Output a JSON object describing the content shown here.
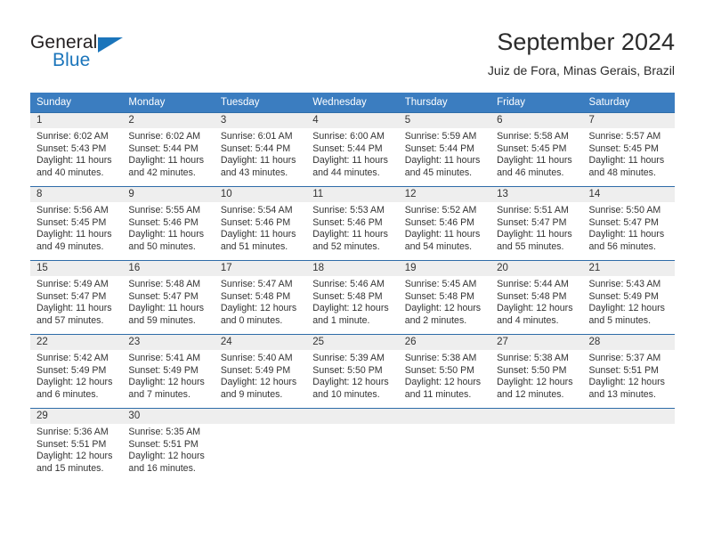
{
  "brand": {
    "name_part1": "General",
    "name_part2": "Blue",
    "logo_color": "#1b75bb"
  },
  "header": {
    "month_title": "September 2024",
    "location": "Juiz de Fora, Minas Gerais, Brazil"
  },
  "theme": {
    "header_bg": "#3b7dc0",
    "row_border": "#2e6ca8",
    "daynum_bg": "#eeeeee"
  },
  "weekday_headers": [
    "Sunday",
    "Monday",
    "Tuesday",
    "Wednesday",
    "Thursday",
    "Friday",
    "Saturday"
  ],
  "weeks": [
    [
      {
        "day": "1",
        "sunrise": "Sunrise: 6:02 AM",
        "sunset": "Sunset: 5:43 PM",
        "daylight_line1": "Daylight: 11 hours",
        "daylight_line2": "and 40 minutes."
      },
      {
        "day": "2",
        "sunrise": "Sunrise: 6:02 AM",
        "sunset": "Sunset: 5:44 PM",
        "daylight_line1": "Daylight: 11 hours",
        "daylight_line2": "and 42 minutes."
      },
      {
        "day": "3",
        "sunrise": "Sunrise: 6:01 AM",
        "sunset": "Sunset: 5:44 PM",
        "daylight_line1": "Daylight: 11 hours",
        "daylight_line2": "and 43 minutes."
      },
      {
        "day": "4",
        "sunrise": "Sunrise: 6:00 AM",
        "sunset": "Sunset: 5:44 PM",
        "daylight_line1": "Daylight: 11 hours",
        "daylight_line2": "and 44 minutes."
      },
      {
        "day": "5",
        "sunrise": "Sunrise: 5:59 AM",
        "sunset": "Sunset: 5:44 PM",
        "daylight_line1": "Daylight: 11 hours",
        "daylight_line2": "and 45 minutes."
      },
      {
        "day": "6",
        "sunrise": "Sunrise: 5:58 AM",
        "sunset": "Sunset: 5:45 PM",
        "daylight_line1": "Daylight: 11 hours",
        "daylight_line2": "and 46 minutes."
      },
      {
        "day": "7",
        "sunrise": "Sunrise: 5:57 AM",
        "sunset": "Sunset: 5:45 PM",
        "daylight_line1": "Daylight: 11 hours",
        "daylight_line2": "and 48 minutes."
      }
    ],
    [
      {
        "day": "8",
        "sunrise": "Sunrise: 5:56 AM",
        "sunset": "Sunset: 5:45 PM",
        "daylight_line1": "Daylight: 11 hours",
        "daylight_line2": "and 49 minutes."
      },
      {
        "day": "9",
        "sunrise": "Sunrise: 5:55 AM",
        "sunset": "Sunset: 5:46 PM",
        "daylight_line1": "Daylight: 11 hours",
        "daylight_line2": "and 50 minutes."
      },
      {
        "day": "10",
        "sunrise": "Sunrise: 5:54 AM",
        "sunset": "Sunset: 5:46 PM",
        "daylight_line1": "Daylight: 11 hours",
        "daylight_line2": "and 51 minutes."
      },
      {
        "day": "11",
        "sunrise": "Sunrise: 5:53 AM",
        "sunset": "Sunset: 5:46 PM",
        "daylight_line1": "Daylight: 11 hours",
        "daylight_line2": "and 52 minutes."
      },
      {
        "day": "12",
        "sunrise": "Sunrise: 5:52 AM",
        "sunset": "Sunset: 5:46 PM",
        "daylight_line1": "Daylight: 11 hours",
        "daylight_line2": "and 54 minutes."
      },
      {
        "day": "13",
        "sunrise": "Sunrise: 5:51 AM",
        "sunset": "Sunset: 5:47 PM",
        "daylight_line1": "Daylight: 11 hours",
        "daylight_line2": "and 55 minutes."
      },
      {
        "day": "14",
        "sunrise": "Sunrise: 5:50 AM",
        "sunset": "Sunset: 5:47 PM",
        "daylight_line1": "Daylight: 11 hours",
        "daylight_line2": "and 56 minutes."
      }
    ],
    [
      {
        "day": "15",
        "sunrise": "Sunrise: 5:49 AM",
        "sunset": "Sunset: 5:47 PM",
        "daylight_line1": "Daylight: 11 hours",
        "daylight_line2": "and 57 minutes."
      },
      {
        "day": "16",
        "sunrise": "Sunrise: 5:48 AM",
        "sunset": "Sunset: 5:47 PM",
        "daylight_line1": "Daylight: 11 hours",
        "daylight_line2": "and 59 minutes."
      },
      {
        "day": "17",
        "sunrise": "Sunrise: 5:47 AM",
        "sunset": "Sunset: 5:48 PM",
        "daylight_line1": "Daylight: 12 hours",
        "daylight_line2": "and 0 minutes."
      },
      {
        "day": "18",
        "sunrise": "Sunrise: 5:46 AM",
        "sunset": "Sunset: 5:48 PM",
        "daylight_line1": "Daylight: 12 hours",
        "daylight_line2": "and 1 minute."
      },
      {
        "day": "19",
        "sunrise": "Sunrise: 5:45 AM",
        "sunset": "Sunset: 5:48 PM",
        "daylight_line1": "Daylight: 12 hours",
        "daylight_line2": "and 2 minutes."
      },
      {
        "day": "20",
        "sunrise": "Sunrise: 5:44 AM",
        "sunset": "Sunset: 5:48 PM",
        "daylight_line1": "Daylight: 12 hours",
        "daylight_line2": "and 4 minutes."
      },
      {
        "day": "21",
        "sunrise": "Sunrise: 5:43 AM",
        "sunset": "Sunset: 5:49 PM",
        "daylight_line1": "Daylight: 12 hours",
        "daylight_line2": "and 5 minutes."
      }
    ],
    [
      {
        "day": "22",
        "sunrise": "Sunrise: 5:42 AM",
        "sunset": "Sunset: 5:49 PM",
        "daylight_line1": "Daylight: 12 hours",
        "daylight_line2": "and 6 minutes."
      },
      {
        "day": "23",
        "sunrise": "Sunrise: 5:41 AM",
        "sunset": "Sunset: 5:49 PM",
        "daylight_line1": "Daylight: 12 hours",
        "daylight_line2": "and 7 minutes."
      },
      {
        "day": "24",
        "sunrise": "Sunrise: 5:40 AM",
        "sunset": "Sunset: 5:49 PM",
        "daylight_line1": "Daylight: 12 hours",
        "daylight_line2": "and 9 minutes."
      },
      {
        "day": "25",
        "sunrise": "Sunrise: 5:39 AM",
        "sunset": "Sunset: 5:50 PM",
        "daylight_line1": "Daylight: 12 hours",
        "daylight_line2": "and 10 minutes."
      },
      {
        "day": "26",
        "sunrise": "Sunrise: 5:38 AM",
        "sunset": "Sunset: 5:50 PM",
        "daylight_line1": "Daylight: 12 hours",
        "daylight_line2": "and 11 minutes."
      },
      {
        "day": "27",
        "sunrise": "Sunrise: 5:38 AM",
        "sunset": "Sunset: 5:50 PM",
        "daylight_line1": "Daylight: 12 hours",
        "daylight_line2": "and 12 minutes."
      },
      {
        "day": "28",
        "sunrise": "Sunrise: 5:37 AM",
        "sunset": "Sunset: 5:51 PM",
        "daylight_line1": "Daylight: 12 hours",
        "daylight_line2": "and 13 minutes."
      }
    ],
    [
      {
        "day": "29",
        "sunrise": "Sunrise: 5:36 AM",
        "sunset": "Sunset: 5:51 PM",
        "daylight_line1": "Daylight: 12 hours",
        "daylight_line2": "and 15 minutes."
      },
      {
        "day": "30",
        "sunrise": "Sunrise: 5:35 AM",
        "sunset": "Sunset: 5:51 PM",
        "daylight_line1": "Daylight: 12 hours",
        "daylight_line2": "and 16 minutes."
      },
      {
        "day": "",
        "sunrise": "",
        "sunset": "",
        "daylight_line1": "",
        "daylight_line2": ""
      },
      {
        "day": "",
        "sunrise": "",
        "sunset": "",
        "daylight_line1": "",
        "daylight_line2": ""
      },
      {
        "day": "",
        "sunrise": "",
        "sunset": "",
        "daylight_line1": "",
        "daylight_line2": ""
      },
      {
        "day": "",
        "sunrise": "",
        "sunset": "",
        "daylight_line1": "",
        "daylight_line2": ""
      },
      {
        "day": "",
        "sunrise": "",
        "sunset": "",
        "daylight_line1": "",
        "daylight_line2": ""
      }
    ]
  ]
}
